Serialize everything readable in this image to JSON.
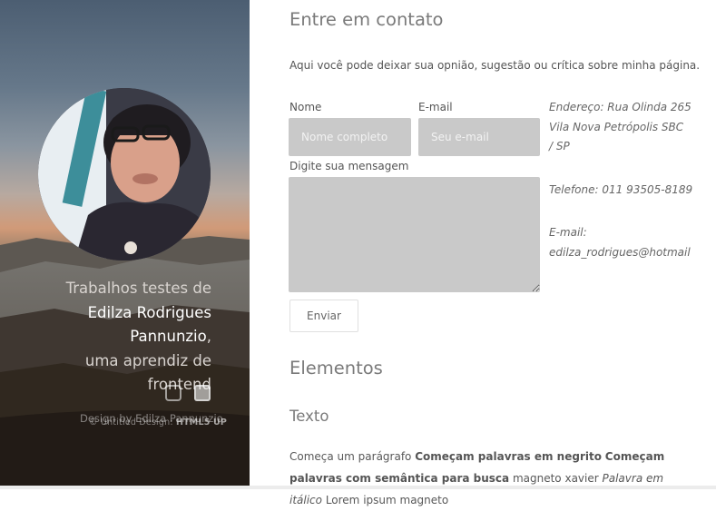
{
  "sidebar": {
    "intro_line": "Trabalhos testes de",
    "name_line1": "Edilza Rodrigues",
    "name_line2": "Pannunzio",
    "name_comma": ",",
    "role_line1": "uma aprendiz de",
    "role_line2": "frontend",
    "copyright": "Design by Edilza Pannunzio",
    "credits_prefix": "© Untitled Design:",
    "credits_link": "HTML5 UP",
    "social": [
      "instagram-icon",
      "facebook-icon"
    ]
  },
  "contact": {
    "title": "Entre em contato",
    "intro": "Aqui você pode deixar sua opnião, sugestão ou crítica sobre minha página.",
    "name_label": "Nome",
    "name_placeholder": "Nome completo",
    "email_label": "E-mail",
    "email_placeholder": "Seu e-mail",
    "message_label": "Digite sua mensagem",
    "submit": "Enviar",
    "address_line1": "Endereço: Rua Olinda 265",
    "address_line2": "Vila Nova Petrópolis SBC",
    "address_line3": "/ SP",
    "phone": "Telefone: 011 93505-8189",
    "email_title": "E-mail:",
    "email_value": "edilza_rodrigues@hotmail"
  },
  "elements": {
    "title": "Elementos",
    "subtitle": "Texto",
    "p_start": "Começa um parágrafo ",
    "p_bold": "Começam palavras em negrito",
    "p_space": " ",
    "p_strong": "Começam palavras com semântica para busca",
    "p_mid": " magneto xavier ",
    "p_italic": "Palavra em itálico",
    "p_end": " Lorem ipsum magneto"
  }
}
